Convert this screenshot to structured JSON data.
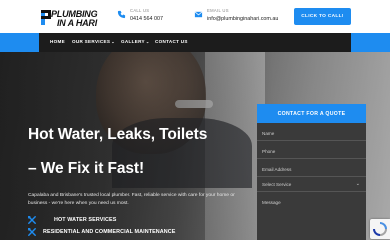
{
  "brand": {
    "line1": "PLUMBING",
    "line2": "IN A HARI"
  },
  "header": {
    "call_label": "CALL US",
    "call_value": "0414 564 007",
    "email_label": "EMAIL US",
    "email_value": "info@plumbinginahari.com.au",
    "cta": "CLICK TO CALL!"
  },
  "nav": {
    "items": [
      {
        "label": "HOME",
        "dropdown": false
      },
      {
        "label": "OUR SERVICES",
        "dropdown": true
      },
      {
        "label": "GALLERY",
        "dropdown": true
      },
      {
        "label": "CONTACT US",
        "dropdown": false
      }
    ]
  },
  "hero": {
    "headline_1": "Hot Water, Leaks, Toilets",
    "headline_2": "– We Fix it Fast!",
    "subtext": "Capalaba and Brisbane's trusted local plumber.  Fast, reliable service with care for your home or business - we're here when you need us most.",
    "features": [
      "HOT WATER SERVICES",
      "RESIDENTIAL AND COMMERCIAL MAINTENANCE"
    ]
  },
  "quote_form": {
    "title": "CONTACT FOR A QUOTE",
    "name_placeholder": "Name",
    "phone_placeholder": "Phone",
    "email_placeholder": "Email Address",
    "service_placeholder": "Select Service",
    "message_placeholder": "Message"
  },
  "colors": {
    "accent": "#1e8cf0",
    "nav_dark": "#1c1c1c",
    "form_bg": "#3a3a3a"
  },
  "icons": [
    "phone-icon",
    "email-icon",
    "wrench-icon",
    "chevron-down-icon",
    "recaptcha-icon"
  ]
}
